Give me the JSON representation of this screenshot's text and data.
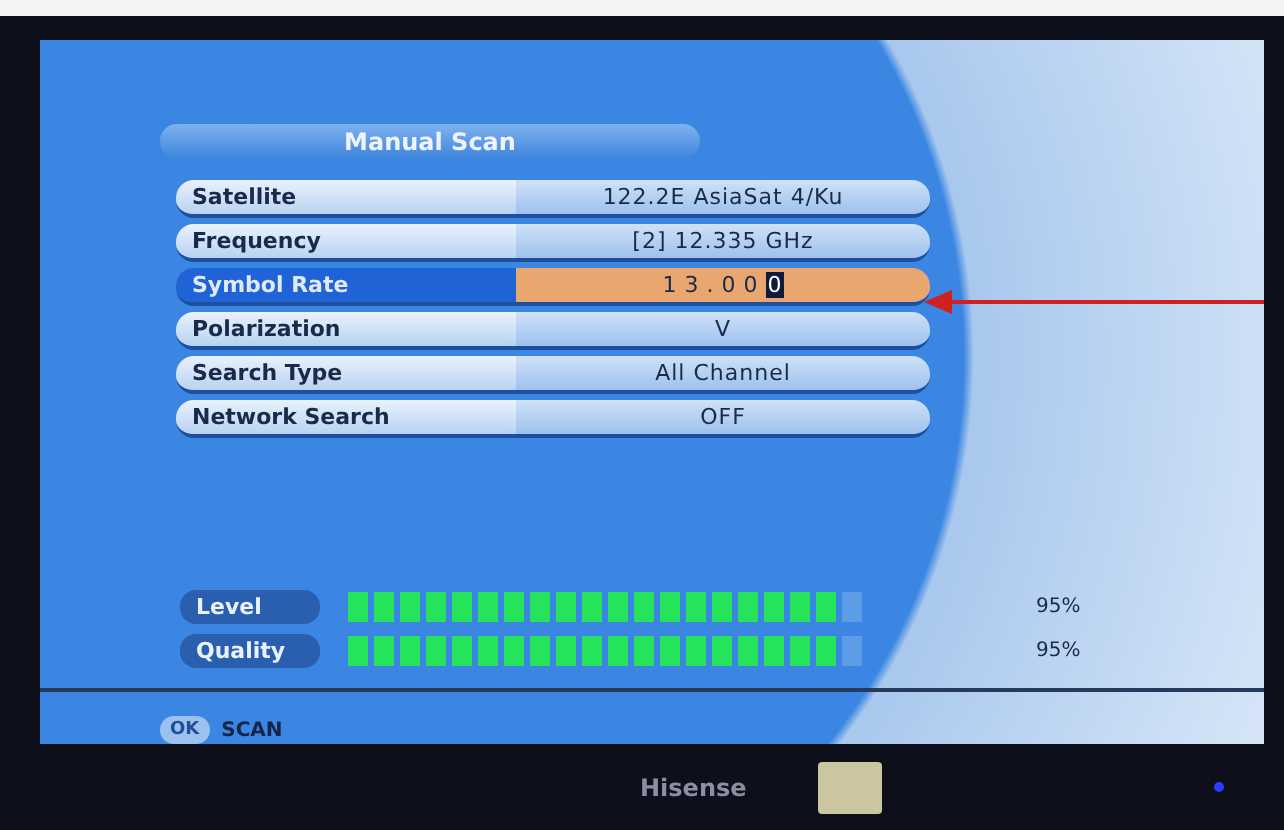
{
  "menu": {
    "title": "Manual Scan",
    "rows": [
      {
        "label": "Satellite",
        "value": "122.2E AsiaSat 4/Ku",
        "selected": false
      },
      {
        "label": "Frequency",
        "value": "[2] 12.335 GHz",
        "selected": false
      },
      {
        "label": "Symbol Rate",
        "value": "13.000",
        "selected": true
      },
      {
        "label": "Polarization",
        "value": "V",
        "selected": false
      },
      {
        "label": "Search Type",
        "value": "All Channel",
        "selected": false
      },
      {
        "label": "Network Search",
        "value": "OFF",
        "selected": false
      }
    ]
  },
  "meters": [
    {
      "label": "Level",
      "level": 0.95,
      "reading": "95%"
    },
    {
      "label": "Quality",
      "level": 0.95,
      "reading": "95%"
    }
  ],
  "footer": {
    "key": "OK",
    "action": "SCAN"
  },
  "bezel": {
    "brand": "Hisense"
  }
}
